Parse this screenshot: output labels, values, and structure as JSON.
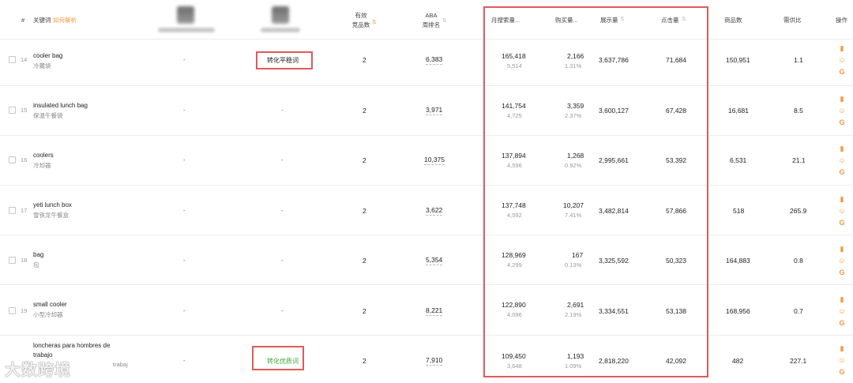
{
  "header": {
    "index": "#",
    "keyword": "关键词",
    "keyword_tag": "如何解析",
    "valid_competitors_line1": "有效",
    "valid_competitors_line2": "竞品数",
    "aba_line1": "ABA",
    "aba_line2": "周排名",
    "monthly_search": "月搜索量...",
    "purchase": "购买量...",
    "impressions": "展示量",
    "clicks": "点击量",
    "products": "商品数",
    "supply_demand": "需供比",
    "actions": "操作"
  },
  "rows": [
    {
      "idx": "14",
      "kw": "cooler bag",
      "kw_cn": "冷藏袋",
      "c2": "-",
      "tag": "转化平稳词",
      "comp": "2",
      "aba": "6,383",
      "search": "165,418",
      "search_sub": "5,514",
      "buy": "2,166",
      "buy_sub": "1.31%",
      "imp": "3,637,786",
      "clk": "71,684",
      "prod": "150,951",
      "ratio": "1.1"
    },
    {
      "idx": "15",
      "kw": "insulated lunch bag",
      "kw_cn": "保温午餐袋",
      "c2": "-",
      "tag": "-",
      "comp": "2",
      "aba": "3,971",
      "search": "141,754",
      "search_sub": "4,725",
      "buy": "3,359",
      "buy_sub": "2.37%",
      "imp": "3,600,127",
      "clk": "67,428",
      "prod": "16,681",
      "ratio": "8.5"
    },
    {
      "idx": "16",
      "kw": "coolers",
      "kw_cn": "冷却器",
      "c2": "-",
      "tag": "-",
      "comp": "2",
      "aba": "10,375",
      "search": "137,894",
      "search_sub": "4,596",
      "buy": "1,268",
      "buy_sub": "0.92%",
      "imp": "2,995,661",
      "clk": "53,392",
      "prod": "6,531",
      "ratio": "21.1"
    },
    {
      "idx": "17",
      "kw": "yeti lunch box",
      "kw_cn": "雪铁龙午餐盒",
      "c2": "-",
      "tag": "-",
      "comp": "2",
      "aba": "3,622",
      "search": "137,748",
      "search_sub": "4,592",
      "buy": "10,207",
      "buy_sub": "7.41%",
      "imp": "3,482,814",
      "clk": "57,866",
      "prod": "518",
      "ratio": "265.9"
    },
    {
      "idx": "18",
      "kw": "bag",
      "kw_cn": "包",
      "c2": "-",
      "tag": "-",
      "comp": "2",
      "aba": "5,354",
      "search": "128,969",
      "search_sub": "4,299",
      "buy": "167",
      "buy_sub": "0.13%",
      "imp": "3,325,592",
      "clk": "50,323",
      "prod": "164,883",
      "ratio": "0.8"
    },
    {
      "idx": "19",
      "kw": "small cooler",
      "kw_cn": "小型冷却器",
      "c2": "-",
      "tag": "-",
      "comp": "2",
      "aba": "8,221",
      "search": "122,890",
      "search_sub": "4,096",
      "buy": "2,691",
      "buy_sub": "2.19%",
      "imp": "3,334,551",
      "clk": "53,138",
      "prod": "168,956",
      "ratio": "0.7"
    },
    {
      "idx": "20",
      "kw": "loncheras para hombres de",
      "kw2": "trabajo",
      "kw_cn": "trabaj",
      "c2": "-",
      "tag": "转化优质词",
      "comp": "2",
      "aba": "7,910",
      "search": "109,450",
      "search_sub": "3,648",
      "buy": "1,193",
      "buy_sub": "1.09%",
      "imp": "2,818,220",
      "clk": "42,092",
      "prod": "482",
      "ratio": "227.1"
    }
  ],
  "watermark": "大数跨境",
  "colors": {
    "tag_orange": "#f19a3e",
    "highlight_red": "#e05a5a",
    "tag_green": "#3aaa35"
  }
}
